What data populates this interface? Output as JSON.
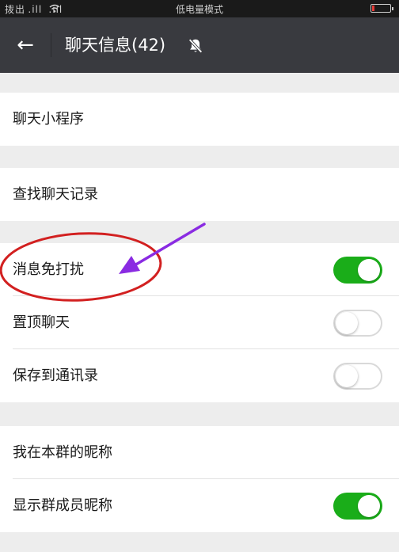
{
  "status_bar": {
    "signal": "拨出 .ill  .ill",
    "mode_text": "低电量模式",
    "battery_level": 0.12,
    "battery_color": "#e53935"
  },
  "header": {
    "back_icon": "←",
    "title": "聊天信息(42)",
    "mute_icon": "bell-off-icon"
  },
  "cells": {
    "mini_programs": "聊天小程序",
    "find_history": "查找聊天记录",
    "mute_notifications": {
      "label": "消息免打扰",
      "on": true
    },
    "pin_chat": {
      "label": "置顶聊天",
      "on": false
    },
    "save_to_contacts": {
      "label": "保存到通讯录",
      "on": false
    },
    "my_group_nickname": "我在本群的昵称",
    "show_member_nicknames": {
      "label": "显示群成员昵称",
      "on": true
    }
  },
  "colors": {
    "header_bg": "#393a3f",
    "switch_on": "#1aad19",
    "annotation_circle": "#d22020",
    "annotation_arrow": "#8a2be2"
  }
}
